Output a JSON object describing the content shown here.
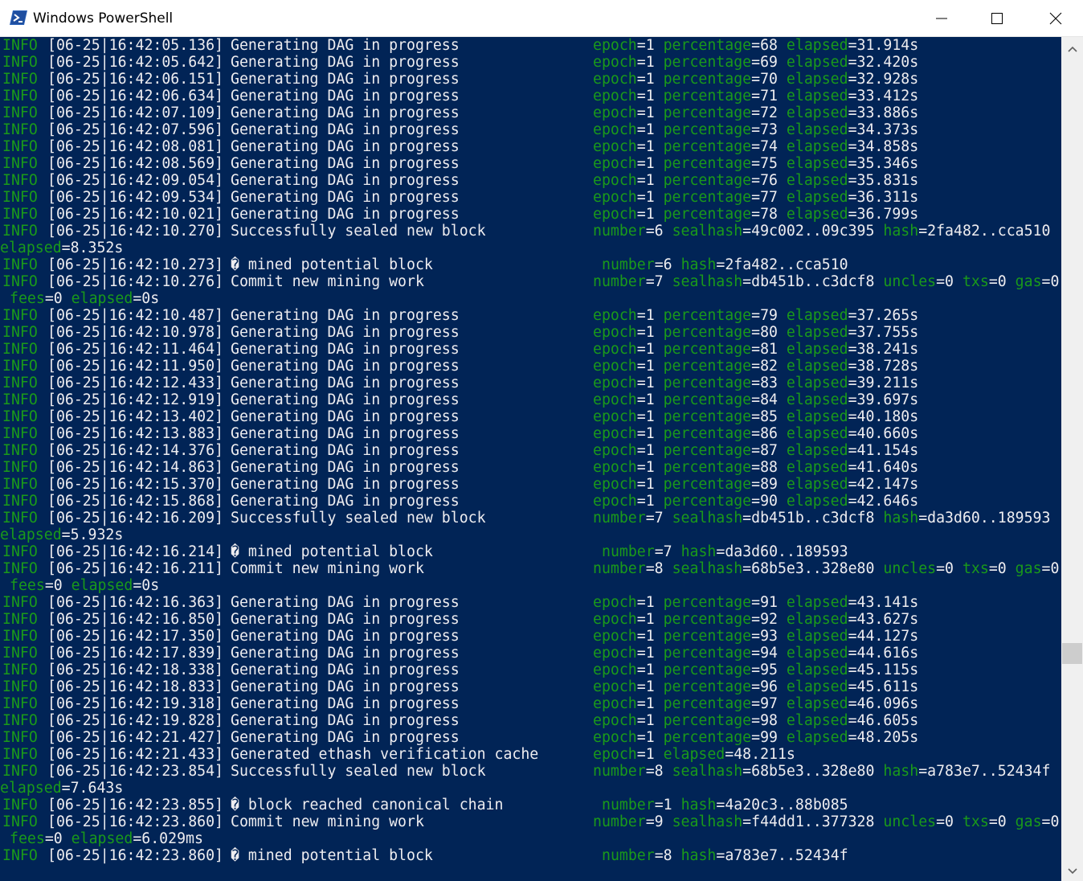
{
  "window": {
    "title": "Windows PowerShell",
    "icon": "powershell-icon",
    "controls": [
      "minimize-icon",
      "maximize-icon",
      "close-icon"
    ]
  },
  "colors": {
    "console_bg": "#012456",
    "text": "#eeedf0",
    "level_and_key": "#1a9a1a",
    "titlebar_bg": "#ffffff",
    "scrollbar_bg": "#f0f0f0",
    "scrollbar_thumb": "#cdcdcd"
  },
  "log": [
    {
      "level": "INFO",
      "ts": "[06-25|16:42:05.136]",
      "msg": "Generating DAG in progress",
      "kv": [
        [
          "epoch",
          "1"
        ],
        [
          "percentage",
          "68"
        ],
        [
          "elapsed",
          "31.914s"
        ]
      ]
    },
    {
      "level": "INFO",
      "ts": "[06-25|16:42:05.642]",
      "msg": "Generating DAG in progress",
      "kv": [
        [
          "epoch",
          "1"
        ],
        [
          "percentage",
          "69"
        ],
        [
          "elapsed",
          "32.420s"
        ]
      ]
    },
    {
      "level": "INFO",
      "ts": "[06-25|16:42:06.151]",
      "msg": "Generating DAG in progress",
      "kv": [
        [
          "epoch",
          "1"
        ],
        [
          "percentage",
          "70"
        ],
        [
          "elapsed",
          "32.928s"
        ]
      ]
    },
    {
      "level": "INFO",
      "ts": "[06-25|16:42:06.634]",
      "msg": "Generating DAG in progress",
      "kv": [
        [
          "epoch",
          "1"
        ],
        [
          "percentage",
          "71"
        ],
        [
          "elapsed",
          "33.412s"
        ]
      ]
    },
    {
      "level": "INFO",
      "ts": "[06-25|16:42:07.109]",
      "msg": "Generating DAG in progress",
      "kv": [
        [
          "epoch",
          "1"
        ],
        [
          "percentage",
          "72"
        ],
        [
          "elapsed",
          "33.886s"
        ]
      ]
    },
    {
      "level": "INFO",
      "ts": "[06-25|16:42:07.596]",
      "msg": "Generating DAG in progress",
      "kv": [
        [
          "epoch",
          "1"
        ],
        [
          "percentage",
          "73"
        ],
        [
          "elapsed",
          "34.373s"
        ]
      ]
    },
    {
      "level": "INFO",
      "ts": "[06-25|16:42:08.081]",
      "msg": "Generating DAG in progress",
      "kv": [
        [
          "epoch",
          "1"
        ],
        [
          "percentage",
          "74"
        ],
        [
          "elapsed",
          "34.858s"
        ]
      ]
    },
    {
      "level": "INFO",
      "ts": "[06-25|16:42:08.569]",
      "msg": "Generating DAG in progress",
      "kv": [
        [
          "epoch",
          "1"
        ],
        [
          "percentage",
          "75"
        ],
        [
          "elapsed",
          "35.346s"
        ]
      ]
    },
    {
      "level": "INFO",
      "ts": "[06-25|16:42:09.054]",
      "msg": "Generating DAG in progress",
      "kv": [
        [
          "epoch",
          "1"
        ],
        [
          "percentage",
          "76"
        ],
        [
          "elapsed",
          "35.831s"
        ]
      ]
    },
    {
      "level": "INFO",
      "ts": "[06-25|16:42:09.534]",
      "msg": "Generating DAG in progress",
      "kv": [
        [
          "epoch",
          "1"
        ],
        [
          "percentage",
          "77"
        ],
        [
          "elapsed",
          "36.311s"
        ]
      ]
    },
    {
      "level": "INFO",
      "ts": "[06-25|16:42:10.021]",
      "msg": "Generating DAG in progress",
      "kv": [
        [
          "epoch",
          "1"
        ],
        [
          "percentage",
          "78"
        ],
        [
          "elapsed",
          "36.799s"
        ]
      ]
    },
    {
      "level": "INFO",
      "ts": "[06-25|16:42:10.270]",
      "msg": "Successfully sealed new block",
      "kv": [
        [
          "number",
          "6"
        ],
        [
          "sealhash",
          "49c002..09c395"
        ],
        [
          "hash",
          "2fa482..cca510"
        ]
      ]
    },
    {
      "cont": [
        [
          "elapsed",
          "8.352s"
        ]
      ]
    },
    {
      "level": "INFO",
      "ts": "[06-25|16:42:10.273]",
      "msg": "� mined potential block",
      "shift": true,
      "kv": [
        [
          "number",
          "6"
        ],
        [
          "hash",
          "2fa482..cca510"
        ]
      ]
    },
    {
      "level": "INFO",
      "ts": "[06-25|16:42:10.276]",
      "msg": "Commit new mining work",
      "kv": [
        [
          "number",
          "7"
        ],
        [
          "sealhash",
          "db451b..c3dcf8"
        ],
        [
          "uncles",
          "0"
        ],
        [
          "txs",
          "0"
        ],
        [
          "gas",
          "0"
        ]
      ]
    },
    {
      "cont": [
        [
          "fees",
          "0"
        ],
        [
          "elapsed",
          "0s"
        ]
      ],
      "indent": true
    },
    {
      "level": "INFO",
      "ts": "[06-25|16:42:10.487]",
      "msg": "Generating DAG in progress",
      "kv": [
        [
          "epoch",
          "1"
        ],
        [
          "percentage",
          "79"
        ],
        [
          "elapsed",
          "37.265s"
        ]
      ]
    },
    {
      "level": "INFO",
      "ts": "[06-25|16:42:10.978]",
      "msg": "Generating DAG in progress",
      "kv": [
        [
          "epoch",
          "1"
        ],
        [
          "percentage",
          "80"
        ],
        [
          "elapsed",
          "37.755s"
        ]
      ]
    },
    {
      "level": "INFO",
      "ts": "[06-25|16:42:11.464]",
      "msg": "Generating DAG in progress",
      "kv": [
        [
          "epoch",
          "1"
        ],
        [
          "percentage",
          "81"
        ],
        [
          "elapsed",
          "38.241s"
        ]
      ]
    },
    {
      "level": "INFO",
      "ts": "[06-25|16:42:11.950]",
      "msg": "Generating DAG in progress",
      "kv": [
        [
          "epoch",
          "1"
        ],
        [
          "percentage",
          "82"
        ],
        [
          "elapsed",
          "38.728s"
        ]
      ]
    },
    {
      "level": "INFO",
      "ts": "[06-25|16:42:12.433]",
      "msg": "Generating DAG in progress",
      "kv": [
        [
          "epoch",
          "1"
        ],
        [
          "percentage",
          "83"
        ],
        [
          "elapsed",
          "39.211s"
        ]
      ]
    },
    {
      "level": "INFO",
      "ts": "[06-25|16:42:12.919]",
      "msg": "Generating DAG in progress",
      "kv": [
        [
          "epoch",
          "1"
        ],
        [
          "percentage",
          "84"
        ],
        [
          "elapsed",
          "39.697s"
        ]
      ]
    },
    {
      "level": "INFO",
      "ts": "[06-25|16:42:13.402]",
      "msg": "Generating DAG in progress",
      "kv": [
        [
          "epoch",
          "1"
        ],
        [
          "percentage",
          "85"
        ],
        [
          "elapsed",
          "40.180s"
        ]
      ]
    },
    {
      "level": "INFO",
      "ts": "[06-25|16:42:13.883]",
      "msg": "Generating DAG in progress",
      "kv": [
        [
          "epoch",
          "1"
        ],
        [
          "percentage",
          "86"
        ],
        [
          "elapsed",
          "40.660s"
        ]
      ]
    },
    {
      "level": "INFO",
      "ts": "[06-25|16:42:14.376]",
      "msg": "Generating DAG in progress",
      "kv": [
        [
          "epoch",
          "1"
        ],
        [
          "percentage",
          "87"
        ],
        [
          "elapsed",
          "41.154s"
        ]
      ]
    },
    {
      "level": "INFO",
      "ts": "[06-25|16:42:14.863]",
      "msg": "Generating DAG in progress",
      "kv": [
        [
          "epoch",
          "1"
        ],
        [
          "percentage",
          "88"
        ],
        [
          "elapsed",
          "41.640s"
        ]
      ]
    },
    {
      "level": "INFO",
      "ts": "[06-25|16:42:15.370]",
      "msg": "Generating DAG in progress",
      "kv": [
        [
          "epoch",
          "1"
        ],
        [
          "percentage",
          "89"
        ],
        [
          "elapsed",
          "42.147s"
        ]
      ]
    },
    {
      "level": "INFO",
      "ts": "[06-25|16:42:15.868]",
      "msg": "Generating DAG in progress",
      "kv": [
        [
          "epoch",
          "1"
        ],
        [
          "percentage",
          "90"
        ],
        [
          "elapsed",
          "42.646s"
        ]
      ]
    },
    {
      "level": "INFO",
      "ts": "[06-25|16:42:16.209]",
      "msg": "Successfully sealed new block",
      "kv": [
        [
          "number",
          "7"
        ],
        [
          "sealhash",
          "db451b..c3dcf8"
        ],
        [
          "hash",
          "da3d60..189593"
        ]
      ]
    },
    {
      "cont": [
        [
          "elapsed",
          "5.932s"
        ]
      ]
    },
    {
      "level": "INFO",
      "ts": "[06-25|16:42:16.214]",
      "msg": "� mined potential block",
      "shift": true,
      "kv": [
        [
          "number",
          "7"
        ],
        [
          "hash",
          "da3d60..189593"
        ]
      ]
    },
    {
      "level": "INFO",
      "ts": "[06-25|16:42:16.211]",
      "msg": "Commit new mining work",
      "kv": [
        [
          "number",
          "8"
        ],
        [
          "sealhash",
          "68b5e3..328e80"
        ],
        [
          "uncles",
          "0"
        ],
        [
          "txs",
          "0"
        ],
        [
          "gas",
          "0"
        ]
      ]
    },
    {
      "cont": [
        [
          "fees",
          "0"
        ],
        [
          "elapsed",
          "0s"
        ]
      ],
      "indent": true
    },
    {
      "level": "INFO",
      "ts": "[06-25|16:42:16.363]",
      "msg": "Generating DAG in progress",
      "kv": [
        [
          "epoch",
          "1"
        ],
        [
          "percentage",
          "91"
        ],
        [
          "elapsed",
          "43.141s"
        ]
      ]
    },
    {
      "level": "INFO",
      "ts": "[06-25|16:42:16.850]",
      "msg": "Generating DAG in progress",
      "kv": [
        [
          "epoch",
          "1"
        ],
        [
          "percentage",
          "92"
        ],
        [
          "elapsed",
          "43.627s"
        ]
      ]
    },
    {
      "level": "INFO",
      "ts": "[06-25|16:42:17.350]",
      "msg": "Generating DAG in progress",
      "kv": [
        [
          "epoch",
          "1"
        ],
        [
          "percentage",
          "93"
        ],
        [
          "elapsed",
          "44.127s"
        ]
      ]
    },
    {
      "level": "INFO",
      "ts": "[06-25|16:42:17.839]",
      "msg": "Generating DAG in progress",
      "kv": [
        [
          "epoch",
          "1"
        ],
        [
          "percentage",
          "94"
        ],
        [
          "elapsed",
          "44.616s"
        ]
      ]
    },
    {
      "level": "INFO",
      "ts": "[06-25|16:42:18.338]",
      "msg": "Generating DAG in progress",
      "kv": [
        [
          "epoch",
          "1"
        ],
        [
          "percentage",
          "95"
        ],
        [
          "elapsed",
          "45.115s"
        ]
      ]
    },
    {
      "level": "INFO",
      "ts": "[06-25|16:42:18.833]",
      "msg": "Generating DAG in progress",
      "kv": [
        [
          "epoch",
          "1"
        ],
        [
          "percentage",
          "96"
        ],
        [
          "elapsed",
          "45.611s"
        ]
      ]
    },
    {
      "level": "INFO",
      "ts": "[06-25|16:42:19.318]",
      "msg": "Generating DAG in progress",
      "kv": [
        [
          "epoch",
          "1"
        ],
        [
          "percentage",
          "97"
        ],
        [
          "elapsed",
          "46.096s"
        ]
      ]
    },
    {
      "level": "INFO",
      "ts": "[06-25|16:42:19.828]",
      "msg": "Generating DAG in progress",
      "kv": [
        [
          "epoch",
          "1"
        ],
        [
          "percentage",
          "98"
        ],
        [
          "elapsed",
          "46.605s"
        ]
      ]
    },
    {
      "level": "INFO",
      "ts": "[06-25|16:42:21.427]",
      "msg": "Generating DAG in progress",
      "kv": [
        [
          "epoch",
          "1"
        ],
        [
          "percentage",
          "99"
        ],
        [
          "elapsed",
          "48.205s"
        ]
      ]
    },
    {
      "level": "INFO",
      "ts": "[06-25|16:42:21.433]",
      "msg": "Generated ethash verification cache",
      "kv": [
        [
          "epoch",
          "1"
        ],
        [
          "elapsed",
          "48.211s"
        ]
      ]
    },
    {
      "level": "INFO",
      "ts": "[06-25|16:42:23.854]",
      "msg": "Successfully sealed new block",
      "kv": [
        [
          "number",
          "8"
        ],
        [
          "sealhash",
          "68b5e3..328e80"
        ],
        [
          "hash",
          "a783e7..52434f"
        ]
      ]
    },
    {
      "cont": [
        [
          "elapsed",
          "7.643s"
        ]
      ]
    },
    {
      "level": "INFO",
      "ts": "[06-25|16:42:23.855]",
      "msg": "� block reached canonical chain",
      "shift": true,
      "kv": [
        [
          "number",
          "1"
        ],
        [
          "hash",
          "4a20c3..88b085"
        ]
      ]
    },
    {
      "level": "INFO",
      "ts": "[06-25|16:42:23.860]",
      "msg": "Commit new mining work",
      "kv": [
        [
          "number",
          "9"
        ],
        [
          "sealhash",
          "f44dd1..377328"
        ],
        [
          "uncles",
          "0"
        ],
        [
          "txs",
          "0"
        ],
        [
          "gas",
          "0"
        ]
      ]
    },
    {
      "cont": [
        [
          "fees",
          "0"
        ],
        [
          "elapsed",
          "6.029ms"
        ]
      ],
      "indent": true
    },
    {
      "level": "INFO",
      "ts": "[06-25|16:42:23.860]",
      "msg": "� mined potential block",
      "shift": true,
      "kv": [
        [
          "number",
          "8"
        ],
        [
          "hash",
          "a783e7..52434f"
        ]
      ]
    }
  ]
}
